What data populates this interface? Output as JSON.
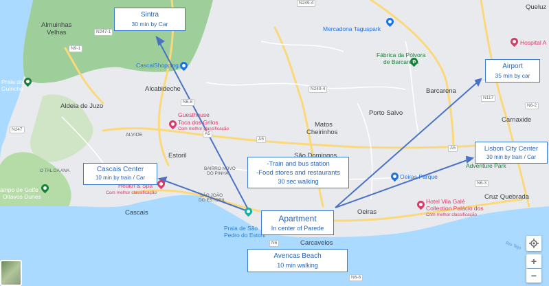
{
  "map": {
    "colors": {
      "sea": "#aadaff",
      "land": "#e8eaed",
      "park": "#9ecf9a",
      "road": "#fbd97a",
      "callout_border": "#3a7bd5",
      "callout_text": "#2b64b3",
      "arrow": "#4a72c4"
    },
    "places": {
      "almuinhas": "Almuinhas",
      "velhas": "Velhas",
      "praia": "Praia do",
      "guincho": "Guincho",
      "alcabideche": "Alcabideche",
      "aldeia_juzo": "Aldeia de Juzo",
      "alvide": "ALVIDE",
      "estoril": "Estoril",
      "bairro1": "BAIRRO NOVO",
      "bairro2": "DO PINHAL",
      "sao_joao1": "SÃO JOÃO",
      "sao_joao2": "DO ESTORIL",
      "cascais": "Cascais",
      "tojal": "O TAL DA ANA",
      "golfe1": "ampo de Golfe",
      "golfe2": "Oitavos Dunes",
      "matos": "Matos",
      "cheirinhos": "Cheirinhos",
      "sao_domingos": "São Domingos",
      "porto_salvo": "Porto Salvo",
      "barcarena": "Barcarena",
      "carnaxide": "Carnaxide",
      "queluz": "Queluz",
      "oeiras": "Oeiras",
      "carcavelos": "Carcavelos",
      "cruz_quebrada": "Cruz Quebrada",
      "praia_sao_pedro1": "Praia de São",
      "praia_sao_pedro2": "Pedro do Estoril",
      "rio_tejo": "Rio Tejo"
    },
    "pois": {
      "mercadona": "Mercadona Taguspark",
      "fabrica1": "Fábrica da Pólvora",
      "fabrica2": "de Barcarena",
      "hospital": "Hospital A",
      "cascaishopping": "CascaiShopping",
      "guesthouse1": "Guesthouse",
      "guesthouse2": "Toca dos Grilos",
      "guesthouse3": "Com melhor classificação",
      "health1": "Health & Spa",
      "health2": "Com melhor classificação",
      "oeiras_parque": "Oeiras Parque",
      "hotel1": "Hotel Vila Galé",
      "hotel2": "Collection Palácio dos",
      "hotel3": "Com melhor classificação",
      "adventure": "Adventure Park"
    },
    "roads": {
      "n247a": "N247-1",
      "n9a": "N9-1",
      "n247b": "N247",
      "a5a": "A5",
      "a5b": "A5",
      "a5c": "A5",
      "a5d": "A5",
      "n6": "N6-8",
      "n249": "N249-4",
      "n117": "N117",
      "n62": "N6-2",
      "n63": "N6-3",
      "n249b": "N249-4",
      "n6b": "N6",
      "n6c": "N6-8"
    },
    "callouts": {
      "sintra": {
        "title": "Sintra",
        "sub": "30 min by  Car"
      },
      "airport": {
        "title": "Airport",
        "sub": "35 min by car"
      },
      "lisbon": {
        "title": "Lisbon City Center",
        "sub": "30 min by train / Car"
      },
      "cascais": {
        "title": "Cascais Center",
        "sub": "10 min by train / Car"
      },
      "train": {
        "line1": "-Train and bus station",
        "line2": "-Food stores and restaurants",
        "sub": "30 sec walking"
      },
      "apartment": {
        "title": "Apartment",
        "sub": "In center of Parede"
      },
      "avencas": {
        "title": "Avencas Beach",
        "sub": "10 min walking"
      }
    },
    "controls": {
      "zoom_in": "+",
      "zoom_out": "−"
    }
  }
}
